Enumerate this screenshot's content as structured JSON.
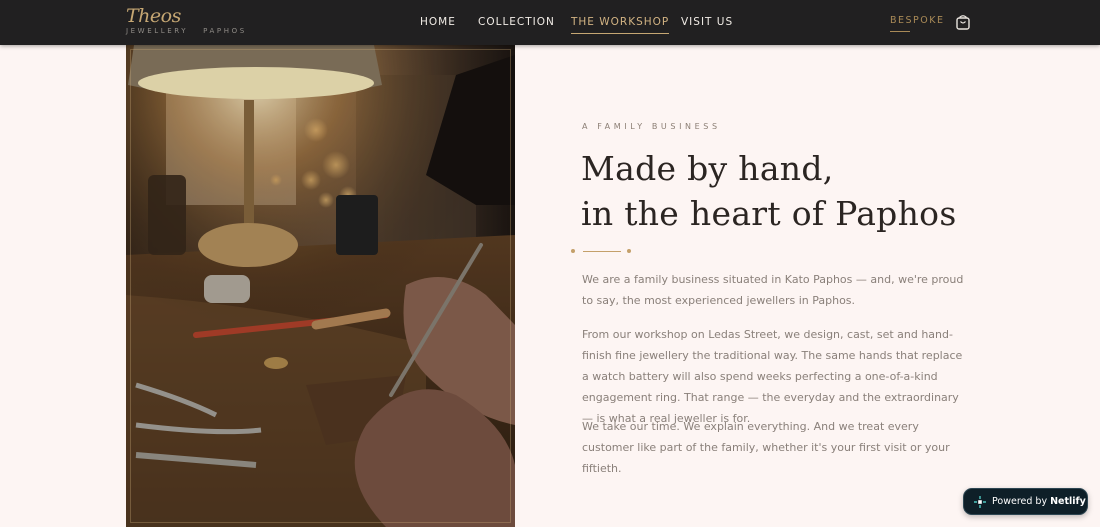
{
  "brand": {
    "name": "Theos",
    "sub_left": "JEWELLERY",
    "sub_right": "PAPHOS"
  },
  "nav": {
    "items": [
      {
        "label": "HOME",
        "active": false
      },
      {
        "label": "COLLECTION",
        "active": false
      },
      {
        "label": "THE WORKSHOP",
        "active": true
      },
      {
        "label": "VISIT US",
        "active": false
      }
    ],
    "bespoke": "BESPOKE",
    "cart_icon": "shopping-bag-icon"
  },
  "hero": {
    "eyebrow": "A FAMILY BUSINESS",
    "heading_line1": "Made by hand,",
    "heading_line2": "in the heart of Paphos",
    "paragraphs": [
      "We are a family business situated in Kato Paphos — and, we're proud to say, the most experienced jewellers in Paphos.",
      "From our workshop on Ledas Street, we design, cast, set and hand-finish fine jewellery the traditional way. The same hands that replace a watch battery will also spend weeks perfecting a one-of-a-kind engagement ring. That range — the everyday and the extraordinary — is what a real jeweller is for.",
      "We take our time. We explain everything. And we treat every customer like part of the family, whether it's your first visit or your fiftieth."
    ]
  },
  "badge": {
    "prefix": "Powered by",
    "name": "Netlify"
  },
  "colors": {
    "header_bg": "#212021",
    "accent_gold": "#c6a773",
    "page_bg": "#fdf5f3",
    "body_text": "#8a807a"
  }
}
